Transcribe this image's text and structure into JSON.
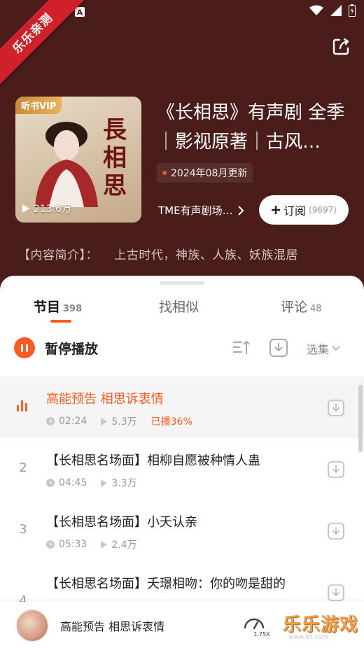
{
  "corner_badge": "乐乐亲测",
  "album": {
    "vip_tag": "听书VIP",
    "cover_art_text": "長相思",
    "play_count": "213.6万",
    "title": "《长相思》有声剧 全季｜影视原著｜古风…",
    "updated": "2024年08月更新",
    "publisher": "TME有声剧场…",
    "subscribe_label": "订阅",
    "subscribe_count": "(9697)",
    "intro": "【内容简介】：  上古时代，神族、人族、妖族混居"
  },
  "tabs": [
    {
      "label": "节目",
      "count": "398"
    },
    {
      "label": "找相似",
      "count": ""
    },
    {
      "label": "评论",
      "count": "48"
    }
  ],
  "toolbar": {
    "pause_label": "暂停播放",
    "select_label": "选集"
  },
  "episodes": [
    {
      "num": "",
      "title": "高能预告 相思诉衷情",
      "duration": "02:24",
      "plays": "5.3万",
      "progress": "已播36%"
    },
    {
      "num": "2",
      "title": "【长相思名场面】相柳自愿被种情人蛊",
      "duration": "04:45",
      "plays": "3.3万",
      "progress": ""
    },
    {
      "num": "3",
      "title": "【长相思名场面】小夭认亲",
      "duration": "05:33",
      "plays": "2.4万",
      "progress": ""
    },
    {
      "num": "4",
      "title": "【长相思名场面】夭璟相吻：你的吻是甜的",
      "duration": "",
      "plays": "",
      "progress": ""
    }
  ],
  "mini_player": {
    "title": "高能预告 相思诉衷情",
    "speed": "1.75X"
  },
  "watermark": {
    "text": "乐乐游戏",
    "url": "www.6ll.com"
  },
  "colors": {
    "hero_bg": "#4a1d1b",
    "accent": "#ff5a1f"
  }
}
